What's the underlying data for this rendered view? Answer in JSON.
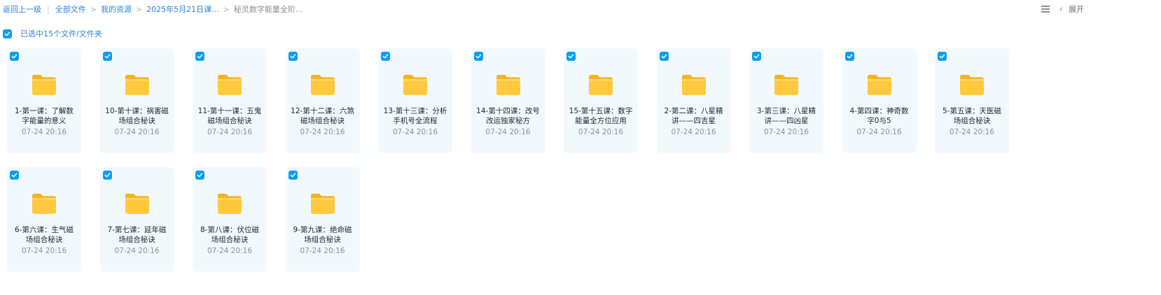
{
  "breadcrumb": {
    "back": "返回上一级",
    "items": [
      "全部文件",
      "我的资源",
      "2025年5月21日课..."
    ],
    "current": "秘灵数字能量全阶..."
  },
  "toolbar": {
    "expand_label": "展开",
    "list_icon": "list-view-icon",
    "chevron_icon": "chevron-left-icon"
  },
  "selection": {
    "label": "已选中15个文件/文件夹",
    "checked": true
  },
  "colors": {
    "accent": "#0b9ef2",
    "link": "#2b84d8",
    "card_bg": "#f2f9fd",
    "folder": "#ffc83d"
  },
  "files": [
    {
      "name": "1-第一课：了解数字能量的意义",
      "time": "07-24 20:16"
    },
    {
      "name": "10-第十课：祸害磁场组合秘诀",
      "time": "07-24 20:16"
    },
    {
      "name": "11-第十一课：五鬼磁场组合秘诀",
      "time": "07-24 20:16"
    },
    {
      "name": "12-第十二课：六煞磁场组合秘诀",
      "time": "07-24 20:16"
    },
    {
      "name": "13-第十三课：分析手机号全流程",
      "time": "07-24 20:16"
    },
    {
      "name": "14-第十四课：改号改运独家秘方",
      "time": "07-24 20:16"
    },
    {
      "name": "15-第十五课：数字能量全方位应用",
      "time": "07-24 20:16"
    },
    {
      "name": "2-第二课：八星精讲——四吉星",
      "time": "07-24 20:16"
    },
    {
      "name": "3-第三课：八星精讲——四凶星",
      "time": "07-24 20:16"
    },
    {
      "name": "4-第四课：神奇数字0与5",
      "time": "07-24 20:16"
    },
    {
      "name": "5-第五课：天医磁场组合秘诀",
      "time": "07-24 20:16"
    },
    {
      "name": "6-第六课：生气磁场组合秘诀",
      "time": "07-24 20:16"
    },
    {
      "name": "7-第七课：延年磁场组合秘诀",
      "time": "07-24 20:16"
    },
    {
      "name": "8-第八课：伏位磁场组合秘诀",
      "time": "07-24 20:16"
    },
    {
      "name": "9-第九课：绝命磁场组合秘诀",
      "time": "07-24 20:16"
    }
  ]
}
